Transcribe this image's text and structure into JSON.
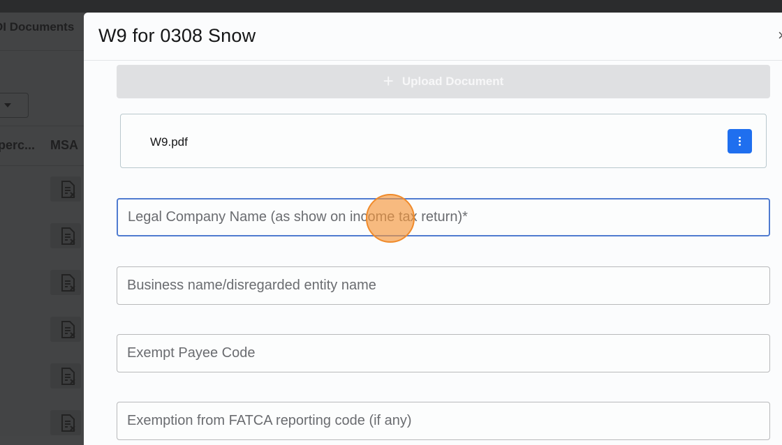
{
  "background": {
    "tab_label": "DI Documents",
    "column_labels": [
      "operc...",
      "MSA"
    ]
  },
  "modal": {
    "title": "W9 for 0308 Snow",
    "close_label": "×",
    "upload_button": {
      "icon": "plus-icon",
      "label": "Upload Document"
    },
    "file": {
      "name": "W9.pdf",
      "menu_icon": "more-vertical-icon"
    },
    "fields": [
      {
        "placeholder": "Legal Company Name (as show on income tax return)*",
        "value": ""
      },
      {
        "placeholder": "Business name/disregarded entity name",
        "value": ""
      },
      {
        "placeholder": "Exempt Payee Code",
        "value": ""
      },
      {
        "placeholder": "Exemption from FATCA reporting code (if any)",
        "value": ""
      }
    ]
  },
  "colors": {
    "accent": "#1f6fef",
    "focus_border": "#4f7bd0",
    "click_indicator": "#f08a2a"
  }
}
